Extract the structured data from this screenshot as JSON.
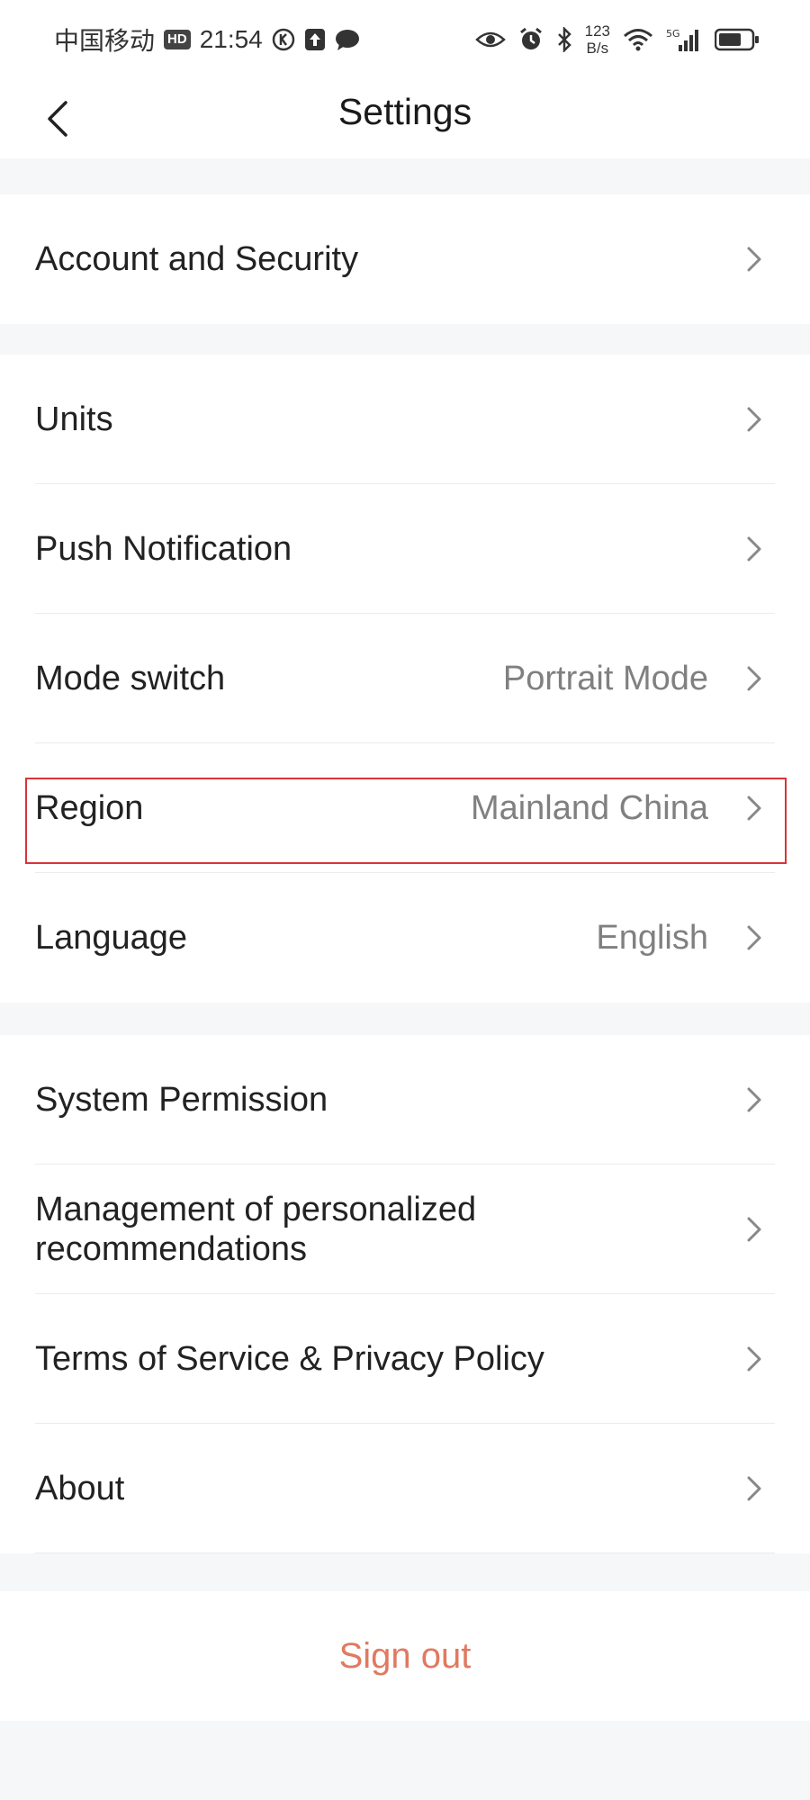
{
  "status_bar": {
    "carrier": "中国移动",
    "hd": "HD",
    "time": "21:54",
    "speed_value": "123",
    "speed_unit": "B/s",
    "network": "5G"
  },
  "header": {
    "title": "Settings",
    "back_icon": "chevron-left-icon"
  },
  "groups": [
    {
      "items": [
        {
          "label": "Account and Security",
          "value": ""
        }
      ]
    },
    {
      "items": [
        {
          "label": "Units",
          "value": ""
        },
        {
          "label": "Push Notification",
          "value": ""
        },
        {
          "label": "Mode switch",
          "value": "Portrait Mode"
        },
        {
          "label": "Region",
          "value": "Mainland China"
        },
        {
          "label": "Language",
          "value": "English"
        }
      ]
    },
    {
      "items": [
        {
          "label": "System Permission",
          "value": ""
        },
        {
          "label": "Management of personalized recommendations",
          "value": ""
        },
        {
          "label": "Terms of Service & Privacy Policy",
          "value": ""
        },
        {
          "label": "About",
          "value": ""
        }
      ]
    }
  ],
  "footer": {
    "sign_out": "Sign out"
  },
  "colors": {
    "background": "#f6f7f9",
    "accent_signout": "#e07a60",
    "highlight": "#d8343a",
    "secondary_text": "#808080"
  }
}
